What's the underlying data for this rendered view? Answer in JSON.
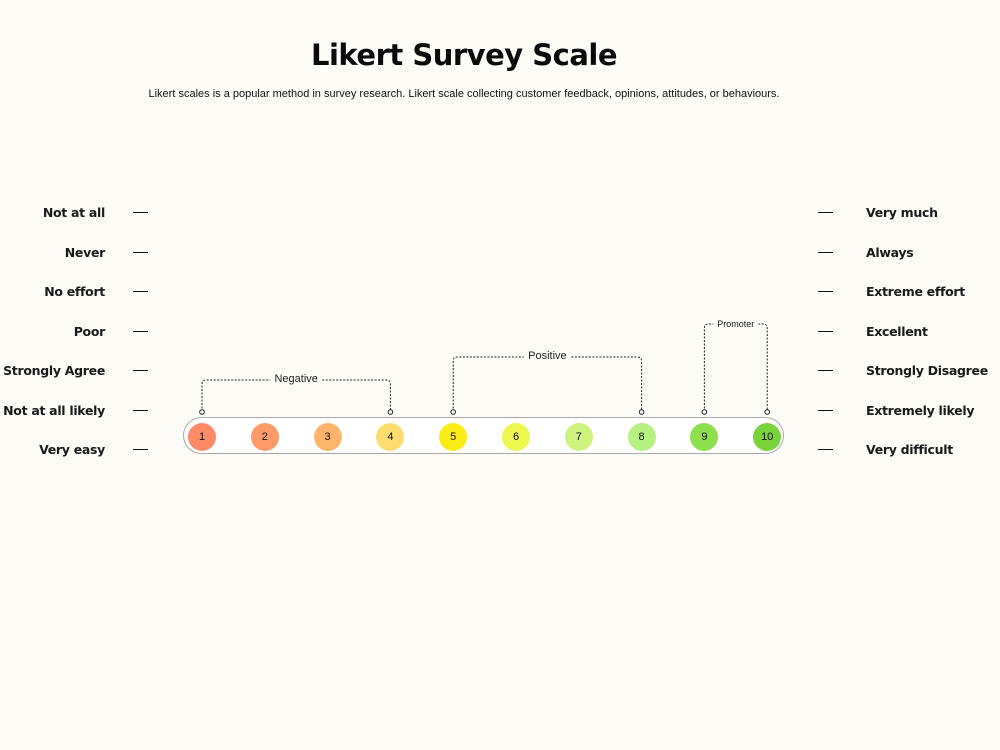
{
  "header": {
    "title": "Likert Survey Scale",
    "subtitle": "Likert scales is a popular method in survey research. Likert scale collecting customer feedback, opinions, attitudes, or behaviours."
  },
  "left_labels": [
    "Not at all",
    "Never",
    "No effort",
    "Poor",
    "Strongly Agree",
    "Not at all likely",
    "Very easy"
  ],
  "right_labels": [
    "Very much",
    "Always",
    "Extreme effort",
    "Excellent",
    "Strongly Disagree",
    "Extremely likely",
    "Very difficult"
  ],
  "scale": [
    {
      "value": "1",
      "color": "#fd8a69"
    },
    {
      "value": "2",
      "color": "#fd9a68"
    },
    {
      "value": "3",
      "color": "#fdb56b"
    },
    {
      "value": "4",
      "color": "#fedd6e"
    },
    {
      "value": "5",
      "color": "#fbec16"
    },
    {
      "value": "6",
      "color": "#eef650"
    },
    {
      "value": "7",
      "color": "#cdf27f"
    },
    {
      "value": "8",
      "color": "#b7f083"
    },
    {
      "value": "9",
      "color": "#8ee04f"
    },
    {
      "value": "10",
      "color": "#7ad33b"
    }
  ],
  "groups": [
    {
      "label": "Negative",
      "from": "1",
      "to": "4"
    },
    {
      "label": "Positive",
      "from": "5",
      "to": "8"
    },
    {
      "label": "Promoter",
      "from": "9",
      "to": "10"
    }
  ]
}
